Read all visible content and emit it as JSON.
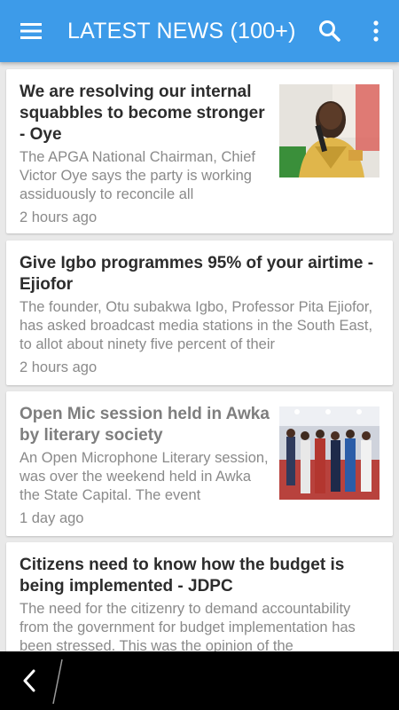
{
  "appbar": {
    "title": "LATEST NEWS (100+)",
    "menu_icon": "hamburger-menu-icon",
    "search_icon": "search-icon",
    "overflow_icon": "more-vertical-icon",
    "color": "#3d9be9"
  },
  "articles": [
    {
      "headline": "We are resolving our internal squabbles to become stronger - Oye",
      "snippet": "The APGA National Chairman, Chief Victor Oye says the party is working assiduously to reconcile all",
      "time": "2 hours ago",
      "read": false,
      "has_image": true
    },
    {
      "headline": "Give Igbo programmes 95% of your airtime - Ejiofor",
      "snippet": "The founder, Otu subakwa Igbo, Professor  Pita Ejiofor, has asked broadcast media stations in the South East, to allot about ninety five percent of their",
      "time": "2 hours ago",
      "read": false,
      "has_image": false
    },
    {
      "headline": "Open Mic session held in Awka by literary society",
      "snippet": "An Open Microphone Literary session, was over the weekend held in Awka the State Capital. The event",
      "time": "1 day ago",
      "read": true,
      "has_image": true
    },
    {
      "headline": "Citizens need to know how the budget is being implemented - JDPC",
      "snippet": "The need for the citizenry to demand accountability from the government for budget implementation has been stressed. This was the opinion of the",
      "time": "",
      "read": false,
      "has_image": false
    }
  ],
  "navbar": {
    "back_icon": "back-chevron-icon"
  }
}
